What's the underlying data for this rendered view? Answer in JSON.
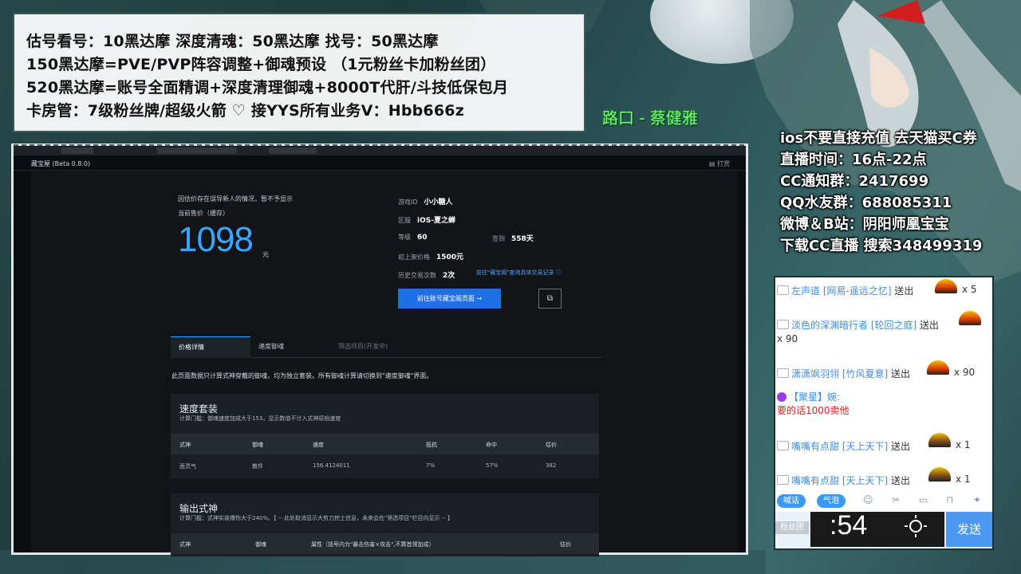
{
  "overlay": {
    "lines": [
      "估号看号：10黑达摩  深度清魂：50黑达摩  找号：50黑达摩",
      "150黑达摩=PVE/PVP阵容调整+御魂预设 （1元粉丝卡加粉丝团）",
      "520黑达摩=账号全面精调+深度清理御魂+8000T代肝/斗技低保包月",
      "卡房管：7级粉丝牌/超级火箭        ♡ 接YYS所有业务V：Hbb666z"
    ],
    "route": "路口 - 蔡健雅",
    "right_info": [
      "ios不要直接充值 去天猫买C券",
      "直播时间：16点-22点",
      "CC通知群：2417699",
      "QQ水友群：688085311",
      "微博＆B站：阴阳师凰宝宝",
      "下载CC直播 搜索348499319"
    ]
  },
  "app": {
    "title": "藏宝屋 (Beta 0.8.0)",
    "top_right": "▤ 打赏",
    "price_note": "因估价存在误导新人的情况，暂不予显示",
    "price_label": "当前售价（缓存）",
    "price": "1098",
    "price_unit": "元",
    "info": {
      "game_id_label": "游戏ID",
      "game_id": "小小糖人",
      "server_label": "区服",
      "server": "iOS-夏之蝉",
      "level_label": "等级",
      "level": "60",
      "signin_label": "签到",
      "signin": "558天",
      "first_price_label": "初上架价格",
      "first_price": "1500元",
      "history_label": "历史交易次数",
      "history": "2次",
      "history_link": "前往\"藏宝阁\"查询具体交易记录 ⓘ"
    },
    "goto_button": "前往账号藏宝阁页面   →",
    "copy_icon": "⧉",
    "tabs": [
      "价格详情",
      "速度御魂",
      "筛选项目(开发中)"
    ],
    "desc": "此页面数据只计算式神穿戴的御魂，均为独立套装。所有御魂计算请切换到\"速度御魂\"界面。",
    "speed_card": {
      "title": "速度套装",
      "sub": "计算门槛：御魂速度加成大于153，显示数值不计入式神原始速度",
      "headers": [
        "式神",
        "御魂",
        "速度",
        "抵抗",
        "命中",
        "估价"
      ],
      "rows": [
        [
          "面灵气",
          "散件",
          "156.4124011",
          "7%",
          "57%",
          "382"
        ]
      ]
    },
    "output_card": {
      "title": "输出式神",
      "sub": "计算门槛：式神实装爆伤大于240%。【 -- 此处取消显示大剪刀挖土信息，未来会在\"筛选项目\"栏目内显示 -- 】",
      "headers": [
        "式神",
        "御魂",
        "属性（括号内为\"暴击伤害×攻击\",不算首领加成）",
        "估价"
      ]
    }
  },
  "chat": {
    "messages": [
      {
        "name": "左声道",
        "room": "[网易-遥远之忆]",
        "action": "送出",
        "count": "x 5"
      },
      {
        "name": "淡色的深渊暗行者",
        "room": "[轮回之庭]",
        "action": "送出",
        "count": "x 90"
      },
      {
        "name": "潇潇飒羽翎",
        "room": "[竹风夏意]",
        "action": "送出",
        "count": "x 90"
      },
      {
        "name": "【聚星】婉:",
        "text": "要的话1000卖他"
      },
      {
        "name": "嘴嘴有点甜",
        "room": "[天上天下]",
        "action": "送出",
        "count": "x 1"
      },
      {
        "name": "嘴嘴有点甜",
        "room": "[天上天下]",
        "action": "送出",
        "count": "x 1"
      }
    ],
    "pills": [
      "喊话",
      "气泡"
    ],
    "toolbar_icons": [
      "smile-icon",
      "scissors-icon",
      "image-icon",
      "lock-icon",
      "puzzle-icon"
    ],
    "fan_tab": "粉丝团",
    "clock_time": ":54",
    "send": "发送"
  }
}
